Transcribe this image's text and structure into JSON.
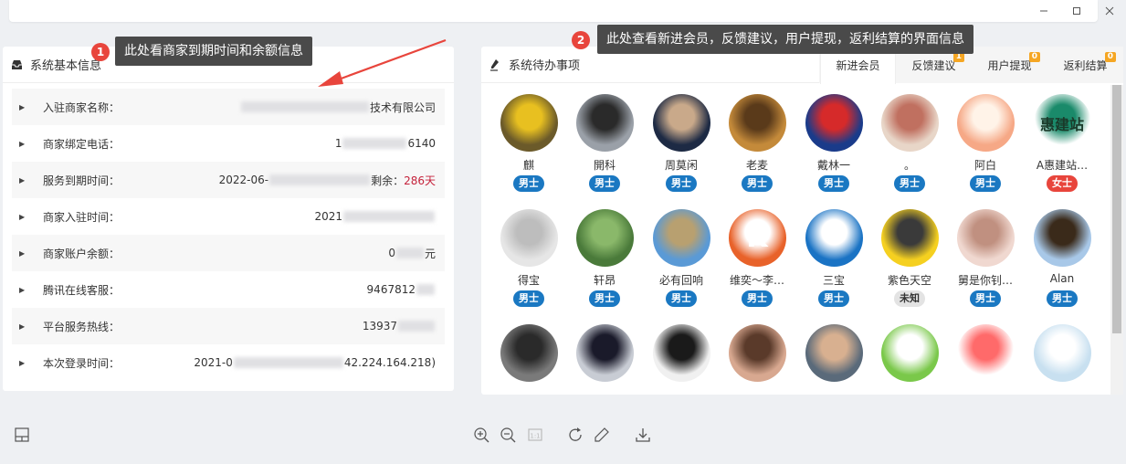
{
  "left_panel": {
    "title": "系统基本信息",
    "rows": [
      {
        "label": "入驻商家名称：",
        "value_pre": "",
        "value_post": "技术有限公司"
      },
      {
        "label": "商家绑定电话：",
        "value_pre": "1",
        "value_post": "6140"
      },
      {
        "label": "服务到期时间：",
        "value_pre": "2022-06-",
        "value_post": "剩余：",
        "extra": "286天"
      },
      {
        "label": "商家入驻时间：",
        "value_pre": "2021",
        "value_post": ""
      },
      {
        "label": "商家账户余额：",
        "value_pre": "0",
        "value_post": "元"
      },
      {
        "label": "腾讯在线客服：",
        "value_pre": "9467812",
        "value_post": ""
      },
      {
        "label": "平台服务热线：",
        "value_pre": "13937",
        "value_post": ""
      },
      {
        "label": "本次登录时间：",
        "value_pre": "2021-0",
        "value_post": "42.224.164.218)"
      }
    ]
  },
  "right_panel": {
    "title": "系统待办事项",
    "tabs": [
      {
        "label": "新进会员",
        "badge": ""
      },
      {
        "label": "反馈建议",
        "badge": "1"
      },
      {
        "label": "用户提现",
        "badge": "0"
      },
      {
        "label": "返利结算",
        "badge": "0"
      }
    ],
    "members": [
      {
        "name": "麒",
        "gender": "男士",
        "g": "m",
        "c1": "#6b5a2a",
        "c2": "#e8c020",
        "ch": ""
      },
      {
        "name": "開科",
        "gender": "男士",
        "g": "m",
        "c1": "#9aa0a8",
        "c2": "#2a2a2a",
        "ch": ""
      },
      {
        "name": "周莫闲",
        "gender": "男士",
        "g": "m",
        "c1": "#1d2a44",
        "c2": "#c9a98a",
        "ch": ""
      },
      {
        "name": "老麦",
        "gender": "男士",
        "g": "m",
        "c1": "#c48a3a",
        "c2": "#5a3a1a",
        "ch": ""
      },
      {
        "name": "戴林一",
        "gender": "男士",
        "g": "m",
        "c1": "#1a3b8a",
        "c2": "#d62a2a",
        "ch": ""
      },
      {
        "name": "。",
        "gender": "男士",
        "g": "m",
        "c1": "#e8d6c8",
        "c2": "#c07060",
        "ch": ""
      },
      {
        "name": "阿白",
        "gender": "男士",
        "g": "m",
        "c1": "#f6a886",
        "c2": "#fff3e8",
        "ch": ""
      },
      {
        "name": "A惠建站…",
        "gender": "女士",
        "g": "f",
        "c1": "#ffffff",
        "c2": "#1a8a6a",
        "ch": "惠建站"
      },
      {
        "name": "得宝",
        "gender": "男士",
        "g": "m",
        "c1": "#e6e6e6",
        "c2": "#bdbdbd",
        "ch": ""
      },
      {
        "name": "轩昂",
        "gender": "男士",
        "g": "m",
        "c1": "#4a7a3a",
        "c2": "#8ab86a",
        "ch": ""
      },
      {
        "name": "必有回响",
        "gender": "男士",
        "g": "m",
        "c1": "#5a9ad6",
        "c2": "#b8a070",
        "ch": ""
      },
      {
        "name": "维奕～李…",
        "gender": "男士",
        "g": "m",
        "c1": "#e8622a",
        "c2": "#ffffff",
        "ch": "K"
      },
      {
        "name": "三宝",
        "gender": "男士",
        "g": "m",
        "c1": "#1a73c4",
        "c2": "#ffffff",
        "ch": ""
      },
      {
        "name": "紫色天空",
        "gender": "未知",
        "g": "u",
        "c1": "#f5d020",
        "c2": "#3a3a3a",
        "ch": ""
      },
      {
        "name": "舅是你钊…",
        "gender": "男士",
        "g": "m",
        "c1": "#f0d8d0",
        "c2": "#c09080",
        "ch": ""
      },
      {
        "name": "Alan",
        "gender": "男士",
        "g": "m",
        "c1": "#a8c8e8",
        "c2": "#3a2a1a",
        "ch": ""
      },
      {
        "name": "",
        "gender": "",
        "g": "m",
        "c1": "#7a7a7a",
        "c2": "#2a2a2a",
        "ch": ""
      },
      {
        "name": "",
        "gender": "",
        "g": "m",
        "c1": "#c8ccd4",
        "c2": "#1a1a2a",
        "ch": ""
      },
      {
        "name": "",
        "gender": "",
        "g": "m",
        "c1": "#f0f0f0",
        "c2": "#1a1a1a",
        "ch": ""
      },
      {
        "name": "",
        "gender": "",
        "g": "m",
        "c1": "#d8a890",
        "c2": "#5a3a2a",
        "ch": ""
      },
      {
        "name": "",
        "gender": "",
        "g": "m",
        "c1": "#5a6a7a",
        "c2": "#d8b090",
        "ch": ""
      },
      {
        "name": "",
        "gender": "",
        "g": "m",
        "c1": "#7ac84a",
        "c2": "#ffffff",
        "ch": ""
      },
      {
        "name": "",
        "gender": "",
        "g": "m",
        "c1": "#ffffff",
        "c2": "#ff6a6a",
        "ch": ""
      },
      {
        "name": "",
        "gender": "",
        "g": "m",
        "c1": "#c8e0f0",
        "c2": "#ffffff",
        "ch": ""
      }
    ]
  },
  "annotations": {
    "tip1_num": "1",
    "tip1_text": "此处看商家到期时间和余额信息",
    "tip2_num": "2",
    "tip2_text": "此处查看新进会员，反馈建议，用户提现，返利结算的界面信息"
  },
  "colors": {
    "male_badge": "#1a78c2",
    "female_badge": "#e8453c",
    "tooltip_bg": "#4a4a4a",
    "marker_red": "#e8453c",
    "tab_badge": "#f5a623"
  }
}
